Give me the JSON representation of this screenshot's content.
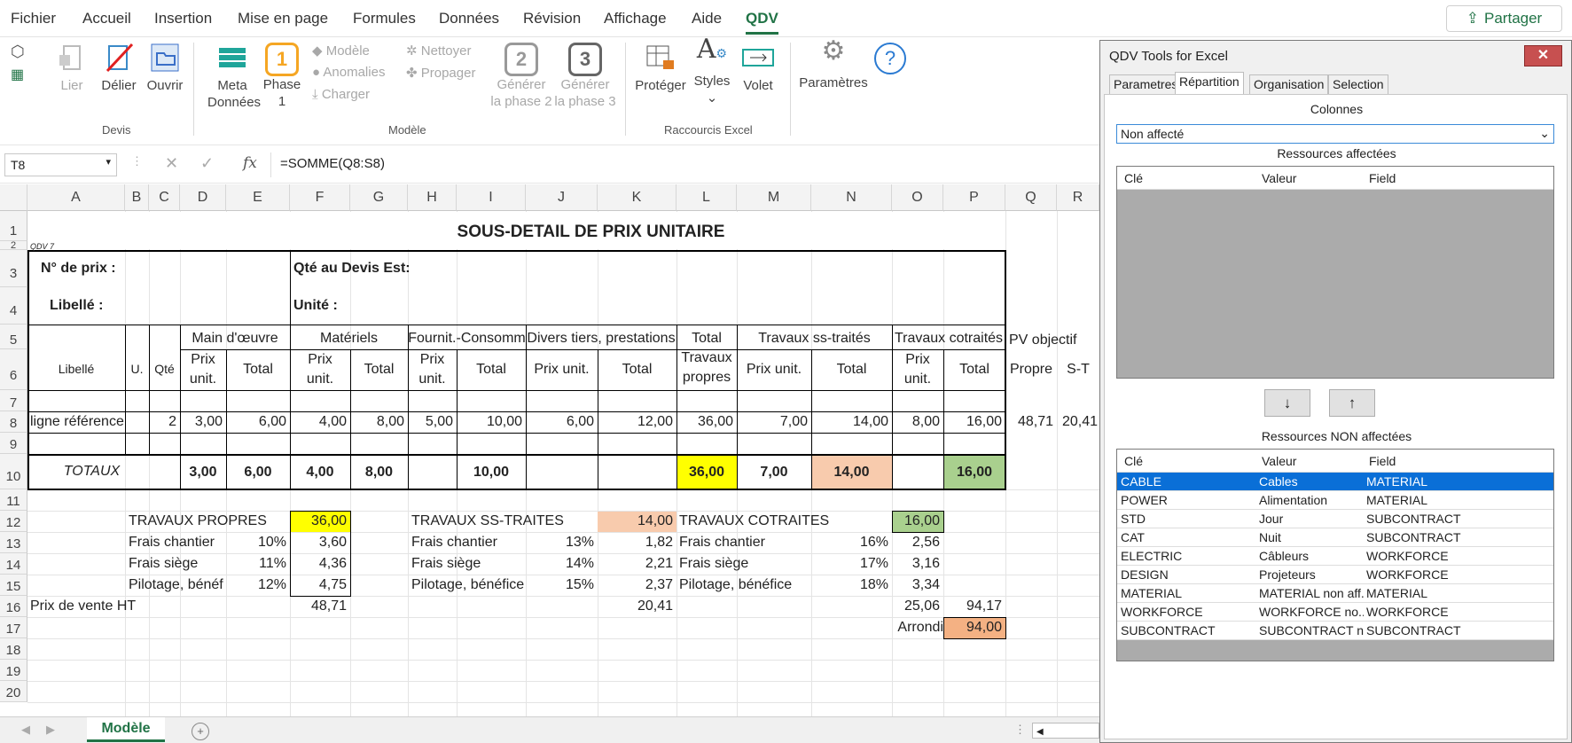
{
  "menu": [
    "Fichier",
    "Accueil",
    "Insertion",
    "Mise en page",
    "Formules",
    "Données",
    "Révision",
    "Affichage",
    "Aide",
    "QDV"
  ],
  "share": "Partager",
  "ribbon": {
    "lier": "Lier",
    "delier": "Délier",
    "ouvrir": "Ouvrir",
    "devis": "Devis",
    "meta1": "Meta",
    "meta2": "Données",
    "phase1a": "Phase",
    "phase1b": "1",
    "phase_num": "1",
    "modele": "Modèle",
    "anomalies": "Anomalies",
    "charger": "Charger",
    "nettoyer": "Nettoyer",
    "propager": "Propager",
    "g2a": "Générer",
    "g2b": "la phase 2",
    "g3a": "Générer",
    "g3b": "la phase 3",
    "n2": "2",
    "n3": "3",
    "grp_modele": "Modèle",
    "proteger": "Protéger",
    "styles": "Styles",
    "volet": "Volet",
    "raccourcis": "Raccourcis Excel",
    "parametres": "Paramètres"
  },
  "formula_bar": {
    "cell": "T8",
    "formula": "=SOMME(Q8:S8)"
  },
  "columns": [
    "A",
    "B",
    "C",
    "D",
    "E",
    "F",
    "G",
    "H",
    "I",
    "J",
    "K",
    "L",
    "M",
    "N",
    "O",
    "P",
    "Q",
    "R"
  ],
  "rows": [
    "1",
    "2",
    "3",
    "4",
    "5",
    "6",
    "7",
    "8",
    "9",
    "10",
    "11",
    "12",
    "13",
    "14",
    "15",
    "16",
    "17",
    "18",
    "19",
    "20"
  ],
  "sheet": {
    "title": "SOUS-DETAIL DE PRIX UNITAIRE",
    "qdv7": "QDV 7",
    "no_prix": "N° de prix :",
    "qte_devis": "Qté au Devis Est:",
    "libelle": "Libellé :",
    "unite": "Unité :",
    "h_main": "Main d'œuvre",
    "h_mat": "Matériels",
    "h_fourn": "Fournit.-Consomm",
    "h_divers": "Divers tiers, prestations",
    "h_total1": "Total",
    "h_total2": "Travaux",
    "h_total3": "propres",
    "h_sst": "Travaux ss-traités",
    "h_cot": "Travaux cotraités",
    "h_pv": "PV objectif",
    "h_libelle": "Libellé",
    "h_u": "U.",
    "h_qte": "Qté",
    "h_prix": "Prix",
    "h_unit": "unit.",
    "h_tot": "Total",
    "h_prixunit": "Prix unit.",
    "h_propre": "Propre",
    "h_st": "S-T",
    "r8": [
      "ligne référence",
      "2",
      "3,00",
      "6,00",
      "4,00",
      "8,00",
      "5,00",
      "10,00",
      "6,00",
      "12,00",
      "36,00",
      "7,00",
      "14,00",
      "8,00",
      "16,00",
      "48,71",
      "20,41"
    ],
    "totaux": "TOTAUX",
    "r10": [
      "3,00",
      "6,00",
      "4,00",
      "8,00",
      "10,00",
      "36,00",
      "7,00",
      "14,00",
      "16,00"
    ],
    "tp": {
      "title": "TRAVAUX PROPRES",
      "v": "36,00",
      "l1": "Frais chantier",
      "p1": "10%",
      "v1": "3,60",
      "l2": "Frais siège",
      "p2": "11%",
      "v2": "4,36",
      "l3": "Pilotage, bénéf",
      "p3": "12%",
      "v3": "4,75"
    },
    "ts": {
      "title": "TRAVAUX SS-TRAITES",
      "v": "14,00",
      "l1": "Frais chantier",
      "p1": "13%",
      "v1": "1,82",
      "l2": "Frais siège",
      "p2": "14%",
      "v2": "2,21",
      "l3": "Pilotage, bénéfice",
      "p3": "15%",
      "v3": "2,37"
    },
    "tc": {
      "title": "TRAVAUX COTRAITES",
      "v": "16,00",
      "l1": "Frais chantier",
      "p1": "16%",
      "v1": "2,56",
      "l2": "Frais siège",
      "p2": "17%",
      "v2": "3,16",
      "l3": "Pilotage, bénéfice",
      "p3": "18%",
      "v3": "3,34"
    },
    "pv_ht": "Prix de vente HT",
    "pv1": "48,71",
    "pv2": "20,41",
    "pv3": "25,06",
    "pv_tot": "94,17",
    "arrondi": "Arrondi",
    "arrondi_v": "94,00",
    "tab": "Modèle"
  },
  "panel": {
    "title": "QDV Tools for Excel",
    "tabs": [
      "Parametres",
      "Répartition",
      "Organisation",
      "Selection"
    ],
    "colonnes": "Colonnes",
    "dropdown": "Non affecté",
    "aff": "Ressources affectées",
    "nonaff": "Ressources NON affectées",
    "headers": [
      "Clé",
      "Valeur",
      "Field"
    ],
    "down": "↓",
    "up": "↑",
    "rows": [
      [
        "CABLE",
        "Cables",
        "MATERIAL"
      ],
      [
        "POWER",
        "Alimentation",
        "MATERIAL"
      ],
      [
        "STD",
        "Jour",
        "SUBCONTRACT"
      ],
      [
        "CAT",
        "Nuit",
        "SUBCONTRACT"
      ],
      [
        "ELECTRIC",
        "Câbleurs",
        "WORKFORCE"
      ],
      [
        "DESIGN",
        "Projeteurs",
        "WORKFORCE"
      ],
      [
        "MATERIAL",
        "MATERIAL non aff...",
        "MATERIAL"
      ],
      [
        "WORKFORCE",
        "WORKFORCE no...",
        "WORKFORCE"
      ],
      [
        "SUBCONTRACT",
        "SUBCONTRACT n...",
        "SUBCONTRACT"
      ]
    ]
  },
  "colors": {
    "accent": "#217346",
    "yellow": "#ffff00",
    "peach": "#f8cbad",
    "green": "#a9d08e",
    "orange": "#f4b183",
    "selection": "#0a6fd7"
  }
}
